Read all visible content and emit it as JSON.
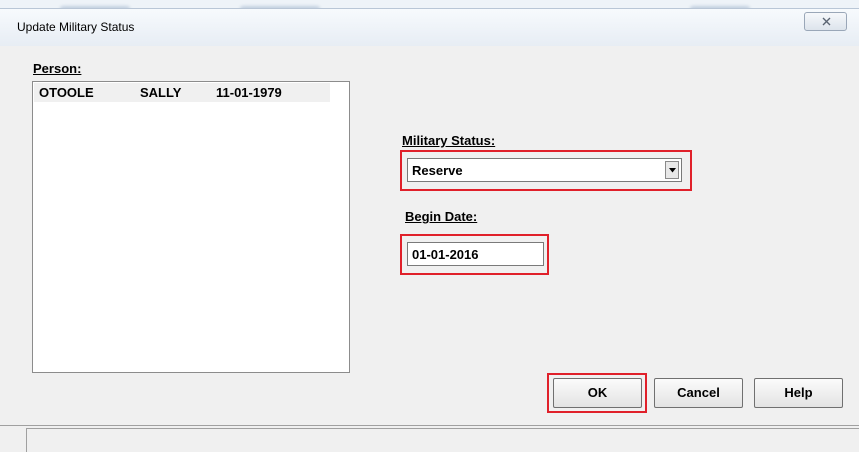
{
  "dialog": {
    "title": "Update Military Status",
    "close_glyph": "✕"
  },
  "person": {
    "label": "Person:",
    "rows": [
      {
        "last": "OTOOLE",
        "first": "SALLY",
        "dob": "11-01-1979"
      }
    ]
  },
  "military_status": {
    "label": "Military Status:",
    "value": "Reserve"
  },
  "begin_date": {
    "label": "Begin Date:",
    "value": "01-01-2016"
  },
  "buttons": {
    "ok": "OK",
    "cancel": "Cancel",
    "help": "Help"
  },
  "colors": {
    "highlight": "#e0202a",
    "dialog_bg": "#f0f0f0"
  }
}
